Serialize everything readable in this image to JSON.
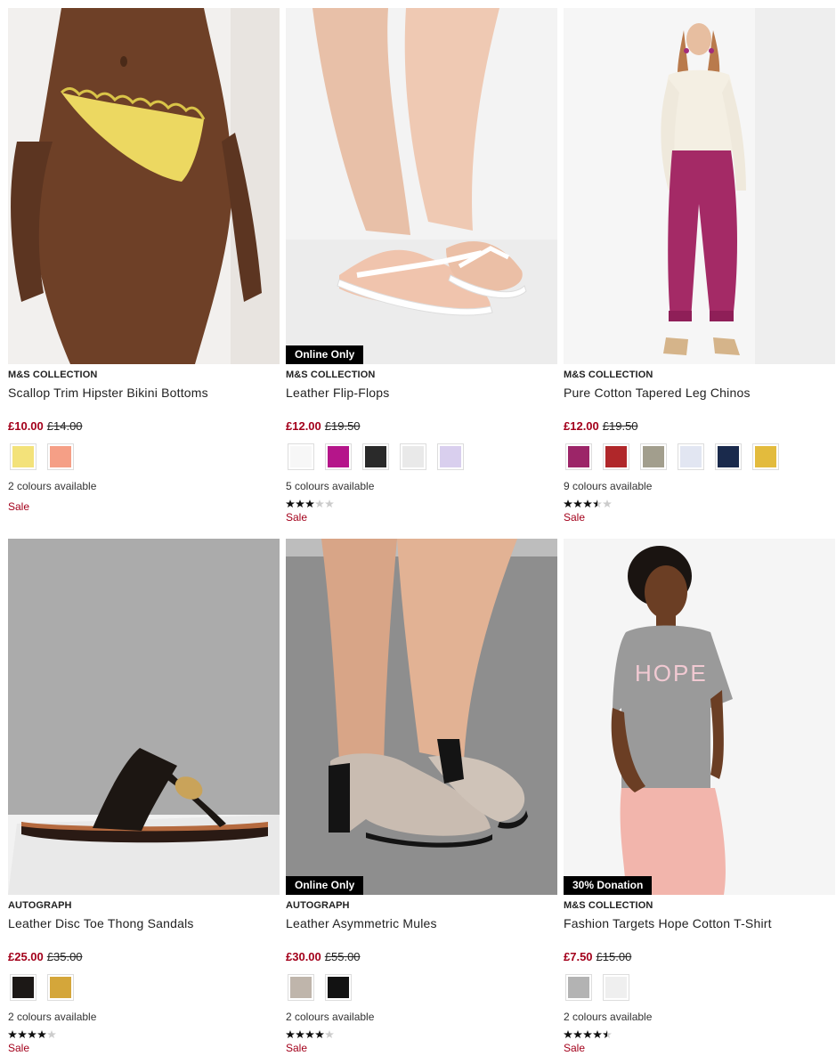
{
  "products": [
    {
      "brand": "M&S COLLECTION",
      "name": "Scallop Trim Hipster Bikini Bottoms",
      "price_now": "£10.00",
      "price_was": "£14.00",
      "swatches": [
        "#f3e27a",
        "#f59f86"
      ],
      "colours_text": "2 colours available",
      "rating": 0,
      "sale": "Sale",
      "badge": ""
    },
    {
      "brand": "M&S COLLECTION",
      "name": "Leather Flip-Flops",
      "price_now": "£12.00",
      "price_was": "£19.50",
      "swatches": [
        "#f7f7f7",
        "#b5158a",
        "#2a2a2a",
        "#e9e9e9",
        "#d9cfee"
      ],
      "colours_text": "5 colours available",
      "rating": 3,
      "sale": "Sale",
      "badge": "Online Only"
    },
    {
      "brand": "M&S COLLECTION",
      "name": "Pure Cotton Tapered Leg Chinos",
      "price_now": "£12.00",
      "price_was": "£19.50",
      "swatches": [
        "#9c2568",
        "#b0272a",
        "#a29e8d",
        "#e2e6f2",
        "#1a2a4c",
        "#e3bb3d"
      ],
      "colours_text": "9 colours available",
      "rating": 3.5,
      "sale": "Sale",
      "badge": ""
    },
    {
      "brand": "AUTOGRAPH",
      "name": "Leather Disc Toe Thong Sandals",
      "price_now": "£25.00",
      "price_was": "£35.00",
      "swatches": [
        "#1c1816",
        "#d4a63a"
      ],
      "colours_text": "2 colours available",
      "rating": 4,
      "sale": "Sale",
      "badge": ""
    },
    {
      "brand": "AUTOGRAPH",
      "name": "Leather Asymmetric Mules",
      "price_now": "£30.00",
      "price_was": "£55.00",
      "swatches": [
        "#bfb5ab",
        "#121212"
      ],
      "colours_text": "2 colours available",
      "rating": 4,
      "sale": "Sale",
      "badge": "Online Only"
    },
    {
      "brand": "M&S COLLECTION",
      "name": "Fashion Targets Hope Cotton T-Shirt",
      "price_now": "£7.50",
      "price_was": "£15.00",
      "swatches": [
        "#b3b3b3",
        "#efefef"
      ],
      "colours_text": "2 colours available",
      "rating": 4.5,
      "sale": "Sale",
      "badge": "30% Donation"
    }
  ],
  "colors": {
    "sale_red": "#a3001b",
    "badge_bg": "#000000"
  }
}
